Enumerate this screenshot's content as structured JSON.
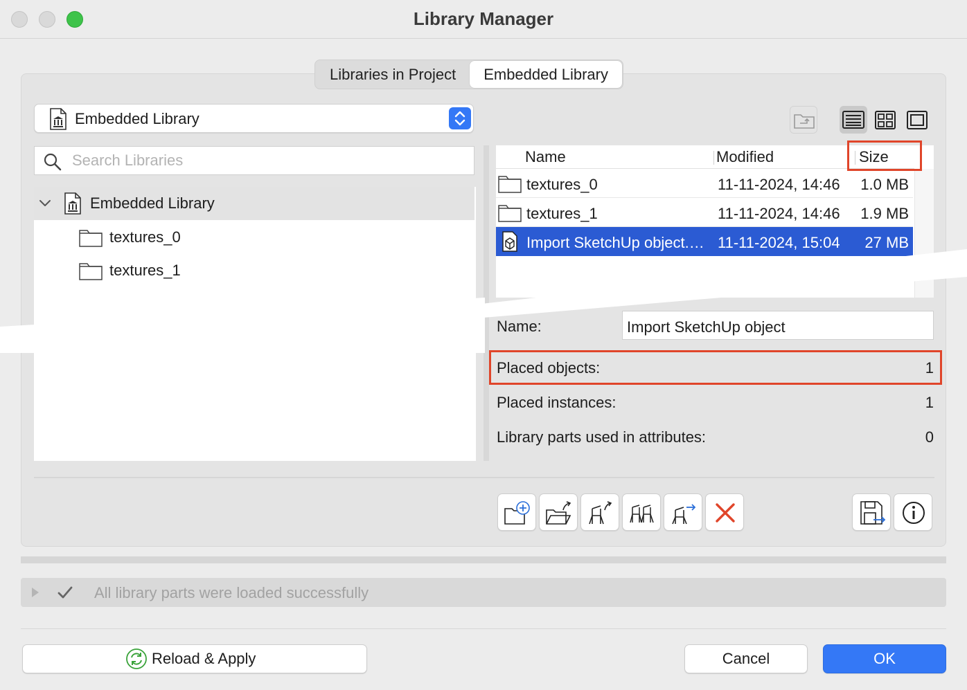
{
  "window": {
    "title": "Library Manager"
  },
  "tabs": [
    {
      "label": "Libraries in Project",
      "active": false
    },
    {
      "label": "Embedded Library",
      "active": true
    }
  ],
  "library_popup": {
    "selected": "Embedded Library"
  },
  "search": {
    "placeholder": "Search Libraries",
    "value": ""
  },
  "tree": {
    "root": "Embedded Library",
    "items": [
      {
        "label": "textures_0"
      },
      {
        "label": "textures_1"
      }
    ]
  },
  "view_toolbar": {
    "icons": [
      "parent-folder-icon",
      "list-view-icon",
      "grid-view-icon",
      "preview-view-icon"
    ],
    "active": "list-view-icon"
  },
  "file_list": {
    "headers": {
      "name": "Name",
      "modified": "Modified",
      "size": "Size"
    },
    "rows": [
      {
        "name": "textures_0",
        "modified": "11-11-2024, 14:46",
        "size": "1.0 MB",
        "icon": "folder-icon",
        "selected": false
      },
      {
        "name": "textures_1",
        "modified": "11-11-2024, 14:46",
        "size": "1.9 MB",
        "icon": "folder-icon",
        "selected": false
      },
      {
        "name": "Import SketchUp object.gsm",
        "modified": "11-11-2024, 15:04",
        "size": "27 MB",
        "icon": "library-part-icon",
        "selected": true
      }
    ]
  },
  "details": {
    "name_label": "Name:",
    "name_value": "Import SketchUp object",
    "placed_objects_label": "Placed objects:",
    "placed_objects_value": "1",
    "placed_instances_label": "Placed instances:",
    "placed_instances_value": "1",
    "attributes_label": "Library parts used in attributes:",
    "attributes_value": "0"
  },
  "actions": [
    "new-folder-icon",
    "import-folder-icon",
    "export-object-icon",
    "duplicate-object-icon",
    "move-object-icon",
    "delete-icon",
    "save-icon",
    "info-icon"
  ],
  "status": {
    "message": "All library parts were loaded successfully"
  },
  "buttons": {
    "reload": "Reload & Apply",
    "cancel": "Cancel",
    "ok": "OK"
  },
  "colors": {
    "accent": "#3478f6",
    "selection": "#2b5bd3",
    "highlight": "#e0452a",
    "delete": "#e0452a"
  }
}
